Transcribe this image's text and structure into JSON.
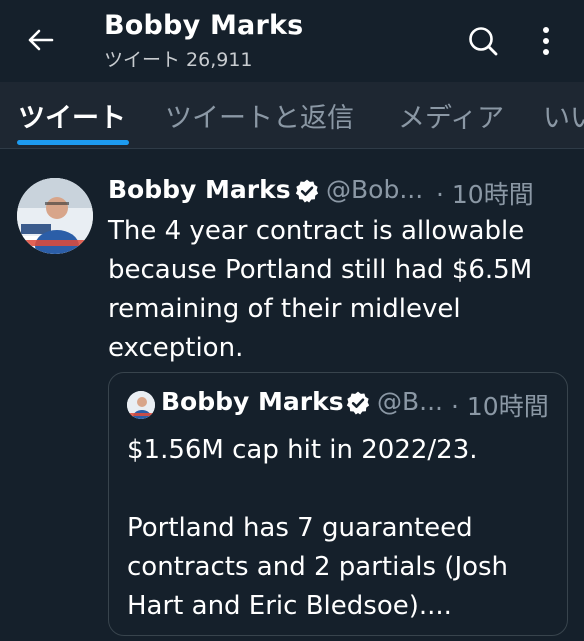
{
  "header": {
    "title": "Bobby Marks",
    "subtitle_label": "ツイート",
    "subtitle_count": "26,911"
  },
  "tabs": [
    {
      "label": "ツイート",
      "active": true
    },
    {
      "label": "ツイートと返信",
      "active": false
    },
    {
      "label": "メディア",
      "active": false
    },
    {
      "label": "いいね",
      "active": false
    }
  ],
  "tweet": {
    "author_name": "Bobby Marks",
    "handle": "@Bob...",
    "time": "· 10時間",
    "text": "The 4 year contract is allowable\nbecause Portland still had $6.5M\nremaining of their midlevel\nexception.",
    "quote": {
      "author_name": "Bobby Marks",
      "handle": "@B...",
      "time": "· 10時間",
      "text": "$1.56M cap hit in 2022/23.\n\nPortland has 7 guaranteed\ncontracts and 2 partials (Josh\nHart and Eric Bledsoe)...."
    }
  },
  "icons": {
    "back": "arrow-left-icon",
    "search": "search-icon",
    "more": "more-vertical-icon",
    "verified": "verified-badge-icon"
  },
  "colors": {
    "background": "#15202b",
    "tab_bar": "#1e2732",
    "accent": "#1d9bf0",
    "muted_text": "#8b98a5"
  }
}
